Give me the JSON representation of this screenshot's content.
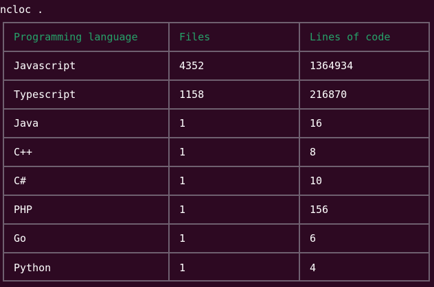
{
  "terminal": {
    "command": "ncloc ."
  },
  "table": {
    "headers": [
      "Programming language",
      "Files",
      "Lines of code"
    ],
    "rows": [
      [
        "Javascript",
        "4352",
        "1364934"
      ],
      [
        "Typescript",
        "1158",
        "216870"
      ],
      [
        "Java",
        "1",
        "16"
      ],
      [
        "C++",
        "1",
        "8"
      ],
      [
        "C#",
        "1",
        "10"
      ],
      [
        "PHP",
        "1",
        "156"
      ],
      [
        "Go",
        "1",
        "6"
      ],
      [
        "Python",
        "1",
        "4"
      ]
    ]
  },
  "colors": {
    "background": "#2d0922",
    "header_text": "#26a269",
    "border": "#6f6070",
    "text": "#ffffff"
  }
}
